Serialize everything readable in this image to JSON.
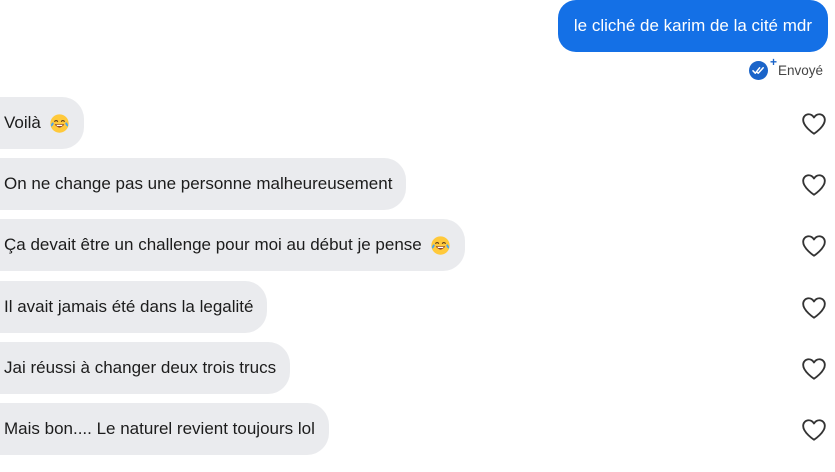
{
  "outgoing": {
    "text": "le cliché de karim de la cité mdr",
    "status": "Envoyé",
    "status_icon": "double-check-icon",
    "accent_color": "#1470e6"
  },
  "incoming": [
    {
      "text": "Voilà",
      "emoji": "face-with-tears-of-joy"
    },
    {
      "text": "On ne change pas une personne malheureusement",
      "emoji": null
    },
    {
      "text": "Ça devait être un challenge pour moi au début je pense",
      "emoji": "face-with-tears-of-joy"
    },
    {
      "text": "Il avait jamais été dans la legalité",
      "emoji": null
    },
    {
      "text": "Jai réussi à changer deux trois trucs",
      "emoji": null
    },
    {
      "text": "Mais bon.... Le naturel revient toujours lol",
      "emoji": null
    }
  ],
  "colors": {
    "incoming_bubble": "#eaebee",
    "outgoing_bubble": "#1470e6",
    "heart_stroke": "#333333"
  }
}
